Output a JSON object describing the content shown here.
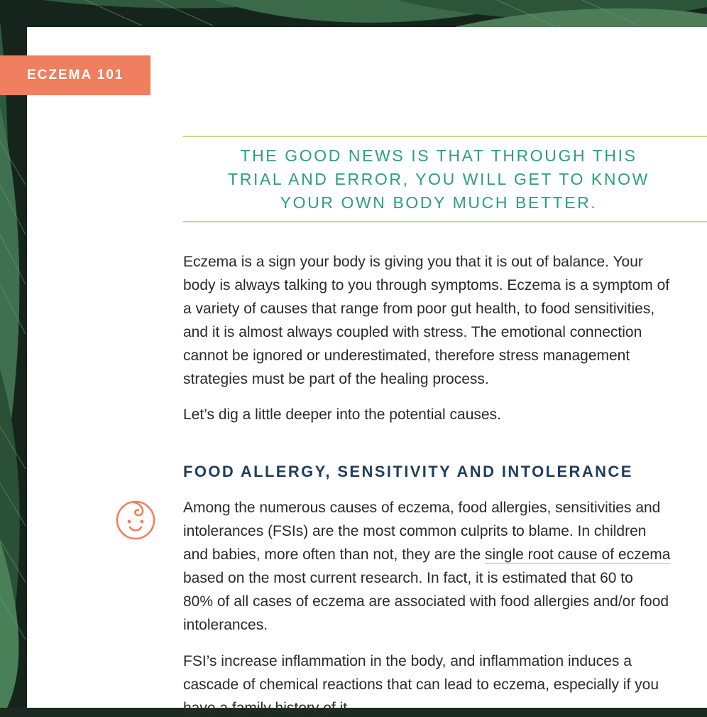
{
  "section_tag": "ECZEMA 101",
  "pull_quote": {
    "lines": [
      "THE GOOD NEWS IS THAT THROUGH THIS",
      "TRIAL AND ERROR, YOU WILL GET TO KNOW",
      "YOUR OWN BODY MUCH BETTER."
    ]
  },
  "intro_paragraph": {
    "lines": [
      "Eczema is a sign your body is giving you that it is out of balance. Your",
      "body is always talking to you through symptoms. Eczema is a symptom of",
      "a variety of causes that range from poor gut health, to food sensitivities,",
      "and it is almost always coupled with stress. The emotional connection",
      "cannot be ignored or underestimated, therefore stress management",
      "strategies must be part of the healing process."
    ]
  },
  "transition_sentence": "Let’s dig a little deeper into the potential causes.",
  "section_heading": "FOOD ALLERGY, SENSITIVITY AND INTOLERANCE",
  "section_paragraph_1": {
    "line_1": "Among the numerous causes of eczema, food allergies, sensitivities and",
    "line_2": "intolerances (FSIs) are the most common culprits to blame. In children",
    "line_3_before_link": "and babies, more often than not, they are the ",
    "line_3_link": "single root cause of eczema",
    "line_4": "based on the most current research. In fact, it is estimated that 60 to",
    "line_5": "80% of all cases of eczema are associated with food allergies and/or food",
    "line_6": "intolerances."
  },
  "section_paragraph_2": {
    "line_1": "FSI’s increase inflammation in the body, and inflammation induces a",
    "line_2": "cascade of chemical reactions that can lead to eczema, especially if you",
    "line_3": "have a family history of it."
  },
  "icons": {
    "baby": "baby-face-icon"
  },
  "colors": {
    "tag": "#f07f5f",
    "pull_quote_text": "#2aa07a",
    "rule": "#c8d88f",
    "heading": "#1f3e5c",
    "body_text": "#2a2a2a"
  }
}
